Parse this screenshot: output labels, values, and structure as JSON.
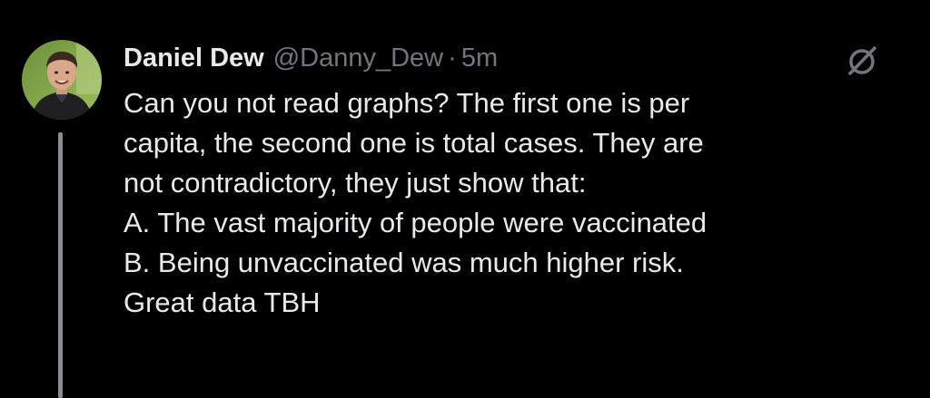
{
  "tweet": {
    "author": {
      "display_name": "Daniel Dew",
      "handle": "@Danny_Dew",
      "avatar": "profile-photo"
    },
    "separator": "·",
    "timestamp": "5m",
    "text_lines": [
      "Can you not read graphs? The first one is per",
      "capita, the second one is total cases. They are",
      "not contradictory, they just show that:",
      "A. The vast majority of people were vaccinated",
      "B. Being unvaccinated was much higher risk.",
      "Great data TBH"
    ],
    "action_icon": "grok-icon"
  },
  "colors": {
    "background": "#000000",
    "text_primary": "#e7e9ea",
    "text_secondary": "#71767b",
    "thread_line": "#8a8d91"
  }
}
